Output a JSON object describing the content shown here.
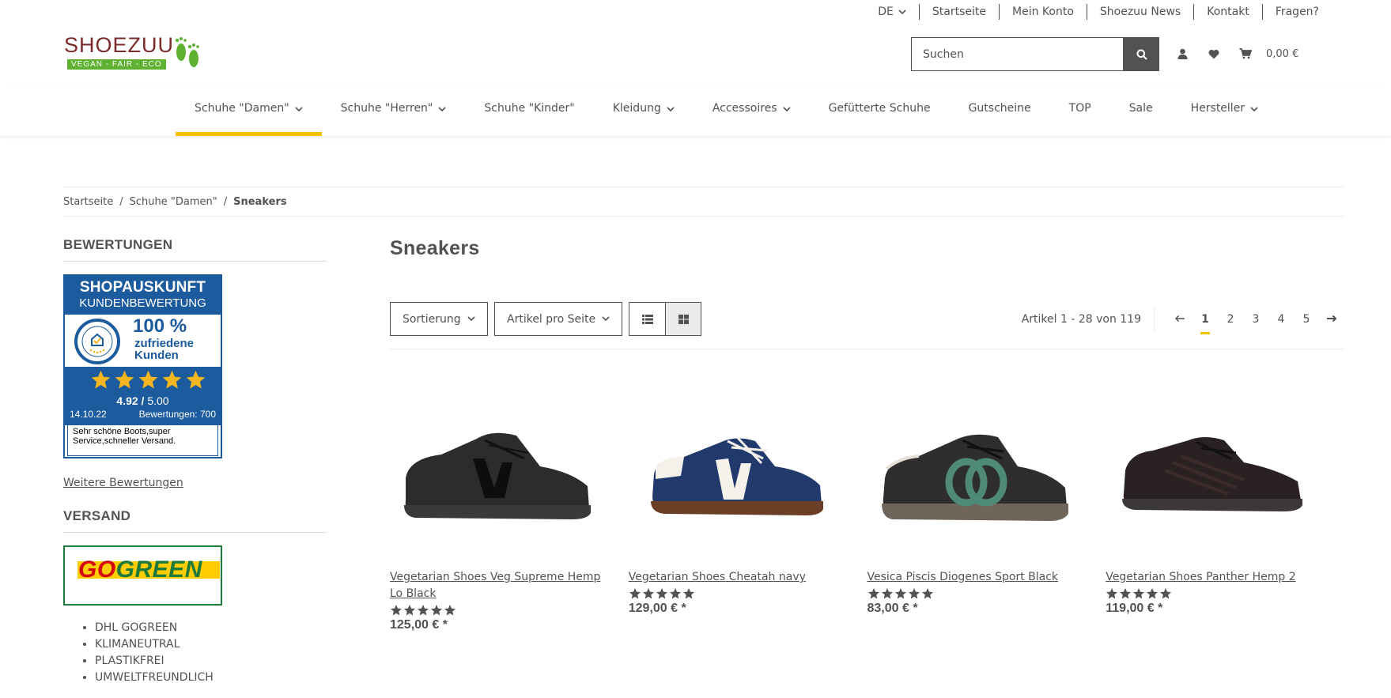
{
  "topbar": {
    "language": "DE",
    "links": [
      "Startseite",
      "Mein Konto",
      "Shoezuu News",
      "Kontakt",
      "Fragen?"
    ]
  },
  "logo": {
    "brand": "SHOEZUU",
    "tagline": "VEGAN - FAIR - ECO"
  },
  "search": {
    "placeholder": "Suchen"
  },
  "cart": {
    "value": "0,00 €"
  },
  "nav": [
    {
      "label": "Schuhe \"Damen\"",
      "dropdown": true,
      "active": true
    },
    {
      "label": "Schuhe \"Herren\"",
      "dropdown": true
    },
    {
      "label": "Schuhe \"Kinder\"",
      "dropdown": false
    },
    {
      "label": "Kleidung",
      "dropdown": true
    },
    {
      "label": "Accessoires",
      "dropdown": true
    },
    {
      "label": "Gefütterte Schuhe",
      "dropdown": false
    },
    {
      "label": "Gutscheine",
      "dropdown": false
    },
    {
      "label": "TOP",
      "dropdown": false
    },
    {
      "label": "Sale",
      "dropdown": false
    },
    {
      "label": "Hersteller",
      "dropdown": true
    }
  ],
  "breadcrumb": {
    "items": [
      "Startseite",
      "Schuhe \"Damen\""
    ],
    "current": "Sneakers"
  },
  "sidebar": {
    "ratings_title": "BEWERTUNGEN",
    "badge": {
      "title": "SHOPAUSKUNFT",
      "subtitle": "KUNDENBEWERTUNG",
      "percent": "100 %",
      "satisfied_line1": "zufriedene",
      "satisfied_line2": "Kunden",
      "score": "4.92",
      "score_sep": " / ",
      "score_max": "5.00",
      "date": "14.10.22",
      "reviews": "Bewertungen: 700",
      "quote": "Sehr schöne Boots,super Service,schneller Versand."
    },
    "more_reviews": "Weitere Bewertungen",
    "shipping_title": "VERSAND",
    "gogreen_go": "GO",
    "gogreen_green": "GREEN",
    "shipping_items": [
      "DHL GOGREEN",
      "KLIMANEUTRAL",
      "PLASTIKFREI",
      "UMWELTFREUNDLICH"
    ]
  },
  "main": {
    "title": "Sneakers",
    "sort_label": "Sortierung",
    "per_page_label": "Artikel pro Seite",
    "article_count": "Artikel 1 - 28 von 119",
    "pages": [
      "1",
      "2",
      "3",
      "4",
      "5"
    ],
    "current_page": "1"
  },
  "products": [
    {
      "title": "Vegetarian Shoes Veg Supreme Hemp Lo Black",
      "price": "125,00 € *",
      "rating": 5,
      "image": "black-sneaker"
    },
    {
      "title": "Vegetarian Shoes Cheatah navy",
      "price": "129,00 € *",
      "rating": 5,
      "image": "navy-sneaker"
    },
    {
      "title": "Vesica Piscis Diogenes Sport Black",
      "price": "83,00 € *",
      "rating": 5,
      "image": "black-green-sneaker"
    },
    {
      "title": "Vegetarian Shoes Panther Hemp 2",
      "price": "119,00 € *",
      "rating": 5,
      "image": "dark-sneaker"
    }
  ],
  "colors": {
    "accent": "#f8bf00",
    "text": "#525252",
    "brand_red": "#7a2b2b",
    "brand_green": "#5fb132",
    "badge_blue": "#1b5b9e"
  }
}
